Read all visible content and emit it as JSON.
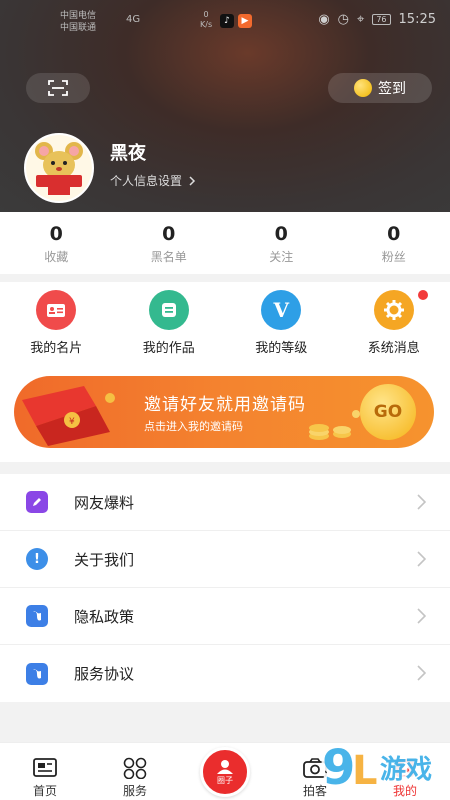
{
  "status_bar": {
    "carrier1": "中国电信",
    "carrier2": "中国联通",
    "signal": "4G",
    "speed_top": "0",
    "speed_bottom": "K/s",
    "battery": "76",
    "time": "15:25"
  },
  "header": {
    "checkin_label": "签到",
    "username": "黑夜",
    "profile_settings_label": "个人信息设置"
  },
  "stats": [
    {
      "value": "0",
      "label": "收藏"
    },
    {
      "value": "0",
      "label": "黑名单"
    },
    {
      "value": "0",
      "label": "关注"
    },
    {
      "value": "0",
      "label": "粉丝"
    }
  ],
  "grid": [
    {
      "label": "我的名片",
      "color": "#f04b4b"
    },
    {
      "label": "我的作品",
      "color": "#34b98f"
    },
    {
      "label": "我的等级",
      "color": "#2e9fe6",
      "glyph": "V"
    },
    {
      "label": "系统消息",
      "color": "#f5a623"
    }
  ],
  "banner": {
    "title": "邀请好友就用邀请码",
    "subtitle": "点击进入我的邀请码",
    "go": "GO"
  },
  "menu": [
    {
      "label": "网友爆料",
      "color": "#8a47e6"
    },
    {
      "label": "关于我们",
      "color": "#3d8fe8"
    },
    {
      "label": "隐私政策",
      "color": "#3d7fe6"
    },
    {
      "label": "服务协议",
      "color": "#3d7fe6"
    }
  ],
  "bottom_nav": [
    {
      "label": "首页"
    },
    {
      "label": "服务"
    },
    {
      "label": "圈子"
    },
    {
      "label": "拍客"
    },
    {
      "label": "我的"
    }
  ],
  "watermark": "9L游戏"
}
